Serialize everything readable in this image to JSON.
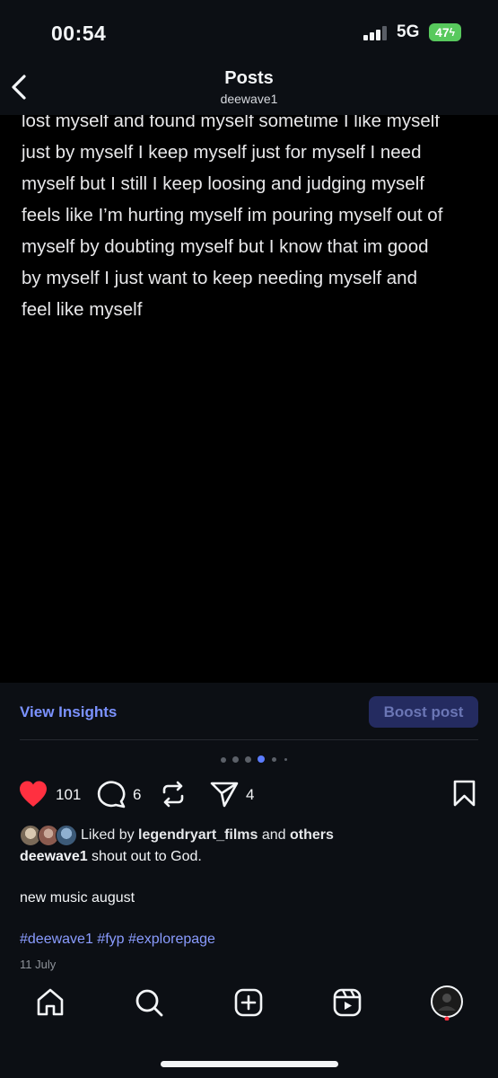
{
  "status": {
    "time": "00:54",
    "network": "5G",
    "battery": "47"
  },
  "header": {
    "title": "Posts",
    "username": "deewave1"
  },
  "post": {
    "lines": [
      "lost myself and found myself sometime I like myself",
      "just by myself  I keep myself just for myself I need",
      "myself but I still I keep loosing and judging myself",
      "feels like I’m hurting myself im pouring myself out of",
      "myself by doubting myself but I know that im good",
      "by myself I just want to keep needing myself and",
      "feel like myself"
    ]
  },
  "insights": {
    "view_label": "View Insights",
    "boost_label": "Boost post"
  },
  "carousel": {
    "total": 6,
    "active": 3
  },
  "actions": {
    "likes": "101",
    "comments": "6",
    "shares": "4"
  },
  "liked_by": {
    "prefix": "Liked by ",
    "user": "legendryart_films",
    "middle": " and ",
    "others": "others"
  },
  "caption": {
    "user": "deewave1",
    "text": " shout out to God."
  },
  "body_text": "new music august",
  "hashtags": "#deewave1 #fyp #explorepage",
  "date": "11 July",
  "colors": {
    "like": "#ff3040",
    "link": "#7b92ff",
    "boost_bg": "#242b60",
    "active_dot": "#5b7cff"
  }
}
